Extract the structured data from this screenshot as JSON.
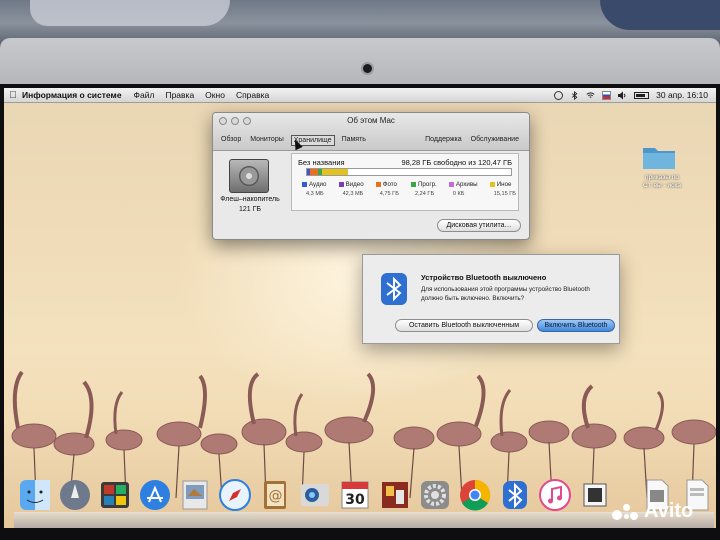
{
  "menubar": {
    "app_name": "Информация о системе",
    "menus": [
      "Файл",
      "Правка",
      "Окно",
      "Справка"
    ],
    "clock": "30 апр.  16:10"
  },
  "about_window": {
    "title": "Об этом Mac",
    "tabs_left": [
      "Обзор",
      "Мониторы",
      "Хранилище",
      "Память"
    ],
    "active_tab": "Хранилище",
    "tabs_right": [
      "Поддержка",
      "Обслуживание"
    ],
    "drive_name": "Флеш–накопитель",
    "drive_size": "121 ГБ",
    "volume_name": "Без названия",
    "volume_free": "98,28 ГБ свободно из 120,47 ГБ",
    "categories": [
      {
        "name": "Аудио",
        "size": "4,3 МБ",
        "color": "#2f5fd0",
        "fraction": 0.002
      },
      {
        "name": "Видео",
        "size": "42,3 МБ",
        "color": "#7a3db8",
        "fraction": 0.004
      },
      {
        "name": "Фото",
        "size": "4,75 ГБ",
        "color": "#e8701f",
        "fraction": 0.039
      },
      {
        "name": "Прогр.",
        "size": "2,24 ГБ",
        "color": "#3aa845",
        "fraction": 0.019
      },
      {
        "name": "Архивы",
        "size": "0 КБ",
        "color": "#c66ad8",
        "fraction": 0.0
      },
      {
        "name": "Иное",
        "size": "15,15 ГБ",
        "color": "#e2c21e",
        "fraction": 0.126
      }
    ],
    "disk_utility_label": "Дисковая утилита…"
  },
  "bluetooth_dialog": {
    "title": "Устройство Bluetooth выключено",
    "message": "Для использования этой программы устройство Bluetooth должно быть включено. Включить?",
    "keep_off_label": "Оставить Bluetooth выключенным",
    "turn_on_label": "Включить Bluetooth"
  },
  "desktop": {
    "folder_label": "приказы по\nСт. вы - иска"
  },
  "dock": {
    "items": [
      "finder-icon",
      "launchpad-icon",
      "photo-booth-icon",
      "app-store-icon",
      "preview-icon",
      "safari-icon",
      "address-book-icon",
      "facetime-icon",
      "calendar-icon",
      "photo-icon",
      "system-preferences-icon",
      "chrome-icon",
      "bluetooth-icon",
      "itunes-icon",
      "system-info-icon",
      "document-icon",
      "document-icon",
      "trash-icon"
    ],
    "calendar_day": "30"
  },
  "watermark": "Avito"
}
